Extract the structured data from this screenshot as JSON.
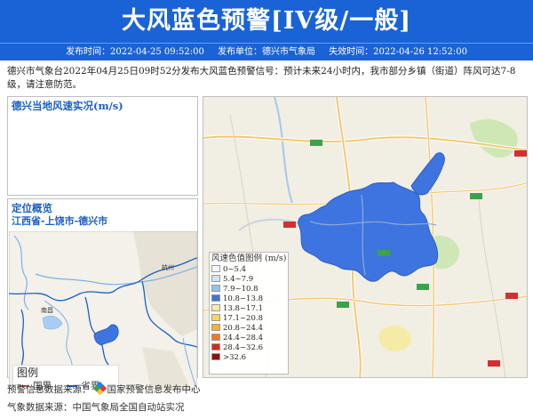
{
  "header": {
    "title": "大风蓝色预警[IV级/一般]",
    "publish_time": "发布时间：2022-04-25 09:52:00",
    "publisher": "发布单位：德兴市气象局",
    "expire_time": "失效时间：2022-04-26 12:52:00"
  },
  "description": "德兴市气象台2022年04月25日09时52分发布大风蓝色预警信号：预计未来24小时内，我市部分乡镇（街道）阵风可达7-8级，请注意防范。",
  "wind_panel": {
    "title": "德兴当地风速实况(m/s)"
  },
  "location_panel": {
    "title": "定位概览",
    "location": "江西省-上饶市-德兴市",
    "map_labels": {
      "hangzhou": "杭州",
      "nanchang": "南昌"
    },
    "legend": {
      "title": "图例",
      "national": "国界",
      "provincial": "省界",
      "national_color": "#c0504d",
      "provincial_color": "#1a5fc8"
    }
  },
  "main_map": {
    "warning_color": "#3d74e0",
    "legend": {
      "title": "风速色值图例 (m/s)",
      "items": [
        {
          "label": "0~5.4",
          "color": "#f4f8fd"
        },
        {
          "label": "5.4~7.9",
          "color": "#cfe3f7"
        },
        {
          "label": "7.9~10.8",
          "color": "#93c3ef"
        },
        {
          "label": "10.8~13.8",
          "color": "#3d74e0"
        },
        {
          "label": "13.8~17.1",
          "color": "#fde9a6"
        },
        {
          "label": "17.1~20.8",
          "color": "#fcd74f"
        },
        {
          "label": "20.8~24.4",
          "color": "#fbb02a"
        },
        {
          "label": "24.4~28.4",
          "color": "#f5761e"
        },
        {
          "label": "28.4~32.6",
          "color": "#d8281e"
        },
        {
          "label": ">32.6",
          "color": "#8b1010"
        }
      ]
    }
  },
  "footer": {
    "warning_source": "预警信息数据来源：",
    "warning_source_name": "国家预警信息发布中心",
    "weather_source": "气象数据来源：中国气象局全国自动站实况"
  }
}
